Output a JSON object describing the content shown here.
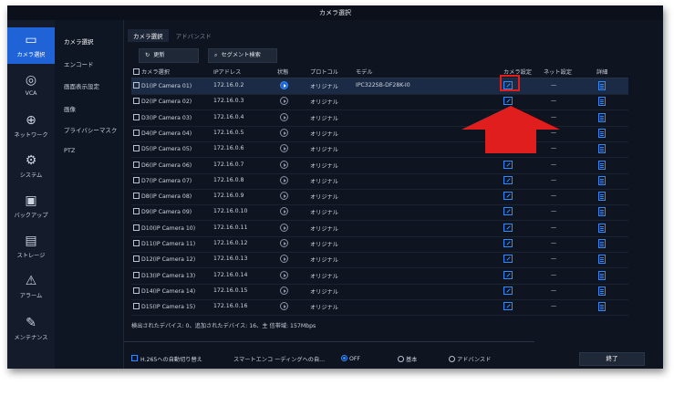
{
  "window": {
    "title": "カメラ選択"
  },
  "sidebar": {
    "items": [
      {
        "label": "カメラ選択",
        "icon": "camera-icon",
        "active": true
      },
      {
        "label": "VCA",
        "icon": "vca-icon",
        "active": false
      },
      {
        "label": "ネットワーク",
        "icon": "globe-icon",
        "active": false
      },
      {
        "label": "システム",
        "icon": "gear-icon",
        "active": false
      },
      {
        "label": "バックアップ",
        "icon": "backup-icon",
        "active": false
      },
      {
        "label": "ストレージ",
        "icon": "storage-icon",
        "active": false
      },
      {
        "label": "アラーム",
        "icon": "warning-icon",
        "active": false
      },
      {
        "label": "メンテナンス",
        "icon": "wrench-icon",
        "active": false
      }
    ]
  },
  "subnav": {
    "items": [
      "カメラ選択",
      "エンコード",
      "画面表示設定",
      "画像",
      "プライバシーマスク",
      "PTZ"
    ]
  },
  "tabs": [
    "カメラ選択",
    "アドバンスド"
  ],
  "toolbar": {
    "refresh_label": "更新",
    "segment_search_label": "セグメント検索"
  },
  "table": {
    "headers": {
      "camera": "カメラ選択",
      "ip": "IPアドレス",
      "status": "状態",
      "protocol": "プロトコル",
      "model": "モデル",
      "camera_settings": "カメラ設定",
      "network_settings": "ネット設定",
      "details": "詳細"
    },
    "rows": [
      {
        "name": "D1(IP Camera 01)",
        "ip": "172.16.0.2",
        "protocol": "オリジナル",
        "model": "IPC322SB-DF28K-I0",
        "net": "—",
        "online": true
      },
      {
        "name": "D2(IP Camera 02)",
        "ip": "172.16.0.3",
        "protocol": "オリジナル",
        "model": "",
        "net": "—",
        "online": false
      },
      {
        "name": "D3(IP Camera 03)",
        "ip": "172.16.0.4",
        "protocol": "オリジナル",
        "model": "",
        "net": "—",
        "online": false
      },
      {
        "name": "D4(IP Camera 04)",
        "ip": "172.16.0.5",
        "protocol": "オリジナル",
        "model": "",
        "net": "—",
        "online": false
      },
      {
        "name": "D5(IP Camera 05)",
        "ip": "172.16.0.6",
        "protocol": "オリジナル",
        "model": "",
        "net": "—",
        "online": false
      },
      {
        "name": "D6(IP Camera 06)",
        "ip": "172.16.0.7",
        "protocol": "オリジナル",
        "model": "",
        "net": "—",
        "online": false
      },
      {
        "name": "D7(IP Camera 07)",
        "ip": "172.16.0.8",
        "protocol": "オリジナル",
        "model": "",
        "net": "—",
        "online": false
      },
      {
        "name": "D8(IP Camera 08)",
        "ip": "172.16.0.9",
        "protocol": "オリジナル",
        "model": "",
        "net": "—",
        "online": false
      },
      {
        "name": "D9(IP Camera 09)",
        "ip": "172.16.0.10",
        "protocol": "オリジナル",
        "model": "",
        "net": "—",
        "online": false
      },
      {
        "name": "D10(IP Camera 10)",
        "ip": "172.16.0.11",
        "protocol": "オリジナル",
        "model": "",
        "net": "—",
        "online": false
      },
      {
        "name": "D11(IP Camera 11)",
        "ip": "172.16.0.12",
        "protocol": "オリジナル",
        "model": "",
        "net": "—",
        "online": false
      },
      {
        "name": "D12(IP Camera 12)",
        "ip": "172.16.0.13",
        "protocol": "オリジナル",
        "model": "",
        "net": "—",
        "online": false
      },
      {
        "name": "D13(IP Camera 13)",
        "ip": "172.16.0.14",
        "protocol": "オリジナル",
        "model": "",
        "net": "—",
        "online": false
      },
      {
        "name": "D14(IP Camera 14)",
        "ip": "172.16.0.15",
        "protocol": "オリジナル",
        "model": "",
        "net": "—",
        "online": false
      },
      {
        "name": "D15(IP Camera 15)",
        "ip": "172.16.0.16",
        "protocol": "オリジナル",
        "model": "",
        "net": "—",
        "online": false
      }
    ]
  },
  "summary": "検出されたデバイス: 0、追加されたデバイス: 16、主 信帯域: 157Mbps",
  "footer": {
    "h265_label": "H.265への自動切り替え",
    "smart_encoding_label": "スマートエンコ ーディングへの自...",
    "options": [
      {
        "label": "OFF",
        "selected": true
      },
      {
        "label": "基本",
        "selected": false
      },
      {
        "label": "アドバンスド",
        "selected": false
      }
    ],
    "close_label": "終了"
  },
  "colors": {
    "accent": "#1f63d6",
    "highlight": "#e01e1e",
    "arrow": "#e01e1e"
  }
}
